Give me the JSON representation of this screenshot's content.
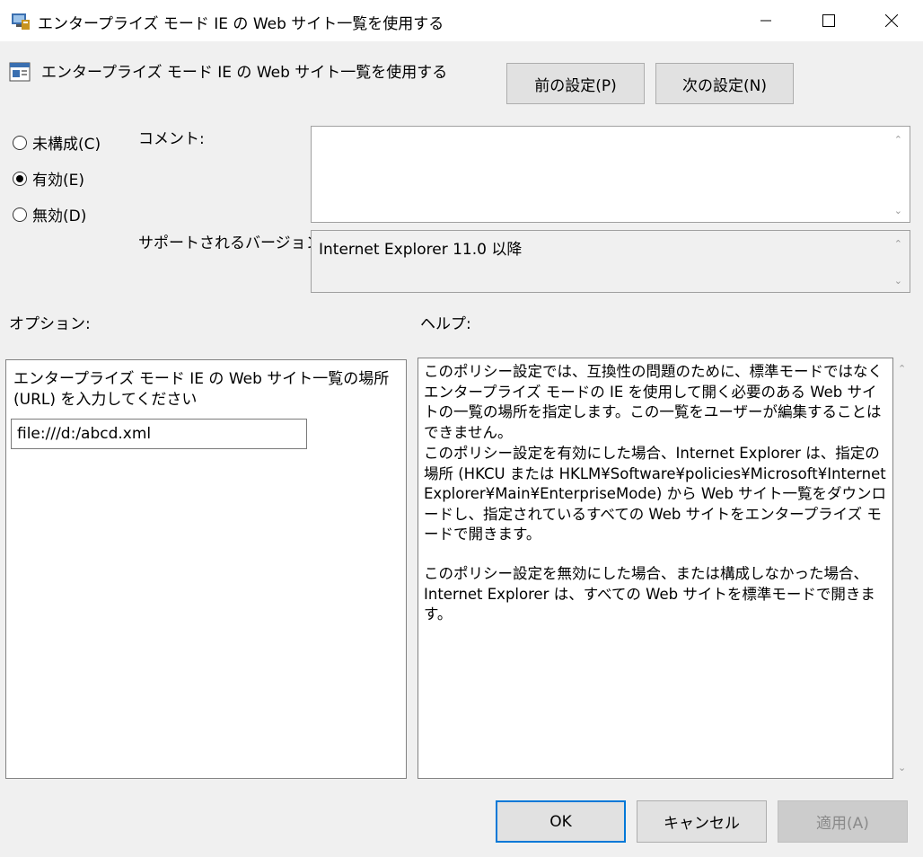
{
  "window": {
    "title": "エンタープライズ モード IE の Web サイト一覧を使用する"
  },
  "header": {
    "title": "エンタープライズ モード IE の Web サイト一覧を使用する",
    "prev_button": "前の設定(P)",
    "next_button": "次の設定(N)"
  },
  "state": {
    "options": [
      {
        "label": "未構成(C)",
        "selected": false
      },
      {
        "label": "有効(E)",
        "selected": true
      },
      {
        "label": "無効(D)",
        "selected": false
      }
    ]
  },
  "comment": {
    "label": "コメント:",
    "value": ""
  },
  "supported": {
    "label": "サポートされるバージョン:",
    "value": "Internet Explorer 11.0 以降"
  },
  "options_section": {
    "label": "オプション:",
    "prompt": "エンタープライズ モード IE の Web サイト一覧の場所 (URL) を入力してください",
    "url_value": "file:///d:/abcd.xml"
  },
  "help_section": {
    "label": "ヘルプ:",
    "paragraphs": [
      "このポリシー設定では、互換性の問題のために、標準モードではなくエンタープライズ モードの IE を使用して開く必要のある Web サイトの一覧の場所を指定します。この一覧をユーザーが編集することはできません。",
      "このポリシー設定を有効にした場合、Internet Explorer は、指定の場所 (HKCU または HKLM¥Software¥policies¥Microsoft¥Internet Explorer¥Main¥EnterpriseMode) から Web サイト一覧をダウンロードし、指定されているすべての Web サイトをエンタープライズ モードで開きます。",
      "このポリシー設定を無効にした場合、または構成しなかった場合、Internet Explorer は、すべての Web サイトを標準モードで開きます。"
    ]
  },
  "footer": {
    "ok": "OK",
    "cancel": "キャンセル",
    "apply": "適用(A)"
  },
  "icons": {
    "title": "policy-app-icon",
    "header": "policy-setting-icon"
  },
  "colors": {
    "accent": "#0078d7",
    "dialog_bg": "#f0f0f0"
  }
}
